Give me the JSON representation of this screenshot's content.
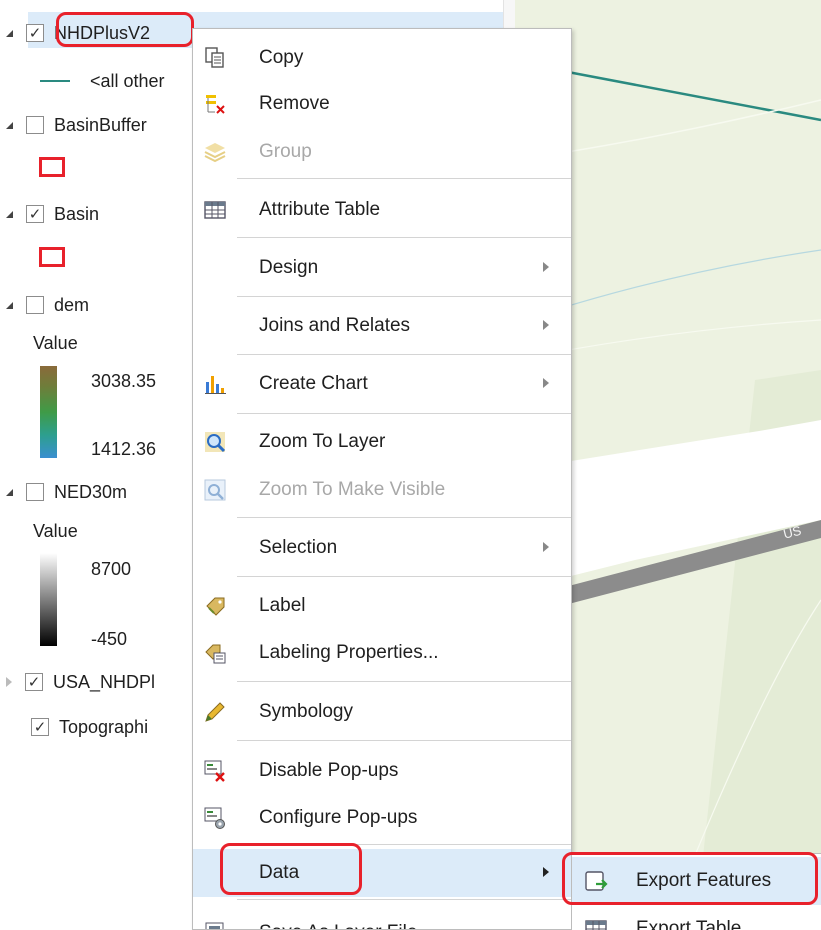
{
  "map": {
    "road_label": "US",
    "colors": {
      "background": "#edf2e1",
      "stream": "#2a8a80",
      "road": "#8c8c8c"
    }
  },
  "contents": {
    "layers": [
      {
        "name": "NHDPlusV2",
        "checked": true,
        "expanded": true,
        "selected": true
      },
      {
        "name": "BasinBuffer",
        "checked": false,
        "expanded": true
      },
      {
        "name": "Basin",
        "checked": true,
        "expanded": true
      },
      {
        "name": "dem",
        "checked": false,
        "expanded": true
      },
      {
        "name": "NED30m",
        "checked": false,
        "expanded": true
      },
      {
        "name": "USA_NHDPl",
        "checked": true,
        "expanded": false
      },
      {
        "name": "Topographi",
        "checked": true,
        "expanded": false
      }
    ],
    "nhd_legend_label": "<all other",
    "dem_legend": {
      "title": "Value",
      "high": "3038.35",
      "low": "1412.36"
    },
    "ned_legend": {
      "title": "Value",
      "high": "8700",
      "low": "-450"
    },
    "checkmark": "✓",
    "annotation_color": "#e8212b",
    "selection_color": "#dcebf9"
  },
  "context_menu": {
    "items": [
      {
        "label": "Copy",
        "icon": "copy-icon"
      },
      {
        "label": "Remove",
        "icon": "remove-icon"
      },
      {
        "label": "Group",
        "icon": "group-icon",
        "disabled": true
      },
      {
        "label": "Attribute Table",
        "icon": "table-icon"
      },
      {
        "label": "Design",
        "submenu": true
      },
      {
        "label": "Joins and Relates",
        "submenu": true
      },
      {
        "label": "Create Chart",
        "icon": "chart-icon",
        "submenu": true
      },
      {
        "label": "Zoom To Layer",
        "icon": "zoom-icon"
      },
      {
        "label": "Zoom To Make Visible",
        "icon": "zoom-visible-icon",
        "disabled": true
      },
      {
        "label": "Selection",
        "submenu": true
      },
      {
        "label": "Label",
        "icon": "label-icon"
      },
      {
        "label": "Labeling Properties...",
        "icon": "labeling-properties-icon"
      },
      {
        "label": "Symbology",
        "icon": "symbology-icon"
      },
      {
        "label": "Disable Pop-ups",
        "icon": "disable-popups-icon"
      },
      {
        "label": "Configure Pop-ups",
        "icon": "configure-popups-icon"
      },
      {
        "label": "Data",
        "submenu": true,
        "active": true
      },
      {
        "label": "Save As Layer File",
        "icon": "save-layer-icon"
      }
    ]
  },
  "data_submenu": {
    "items": [
      {
        "label": "Export Features",
        "icon": "export-features-icon",
        "hover": true
      },
      {
        "label": "Export Table",
        "icon": "export-table-icon"
      }
    ]
  }
}
